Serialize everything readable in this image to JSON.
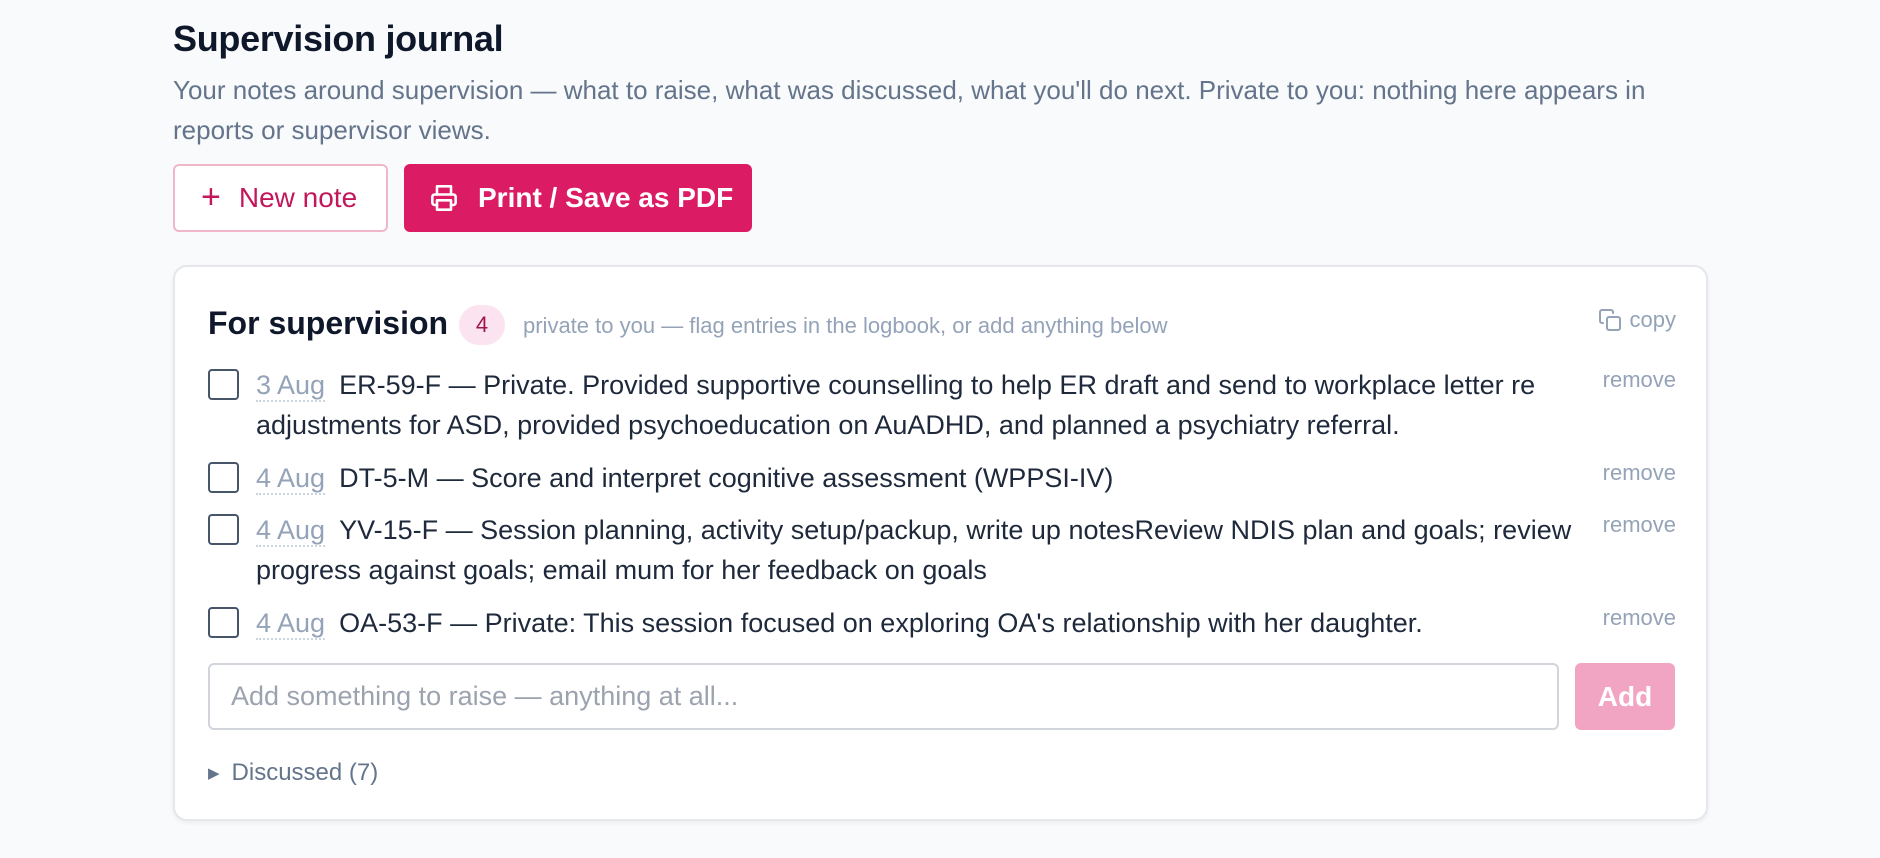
{
  "header": {
    "title": "Supervision journal",
    "subtitle": "Your notes around supervision — what to raise, what was discussed, what you'll do next. Private to you: nothing here appears in reports or supervisor views."
  },
  "toolbar": {
    "new_note_label": "New note",
    "print_label": "Print / Save as PDF"
  },
  "card": {
    "title": "For supervision",
    "count": "4",
    "hint": "private to you — flag entries in the logbook, or add anything below",
    "copy_label": "copy",
    "remove_label": "remove",
    "items": [
      {
        "date": "3 Aug",
        "text": "ER-59-F — Private. Provided supportive counselling to help ER draft and send to workplace letter re adjustments for ASD, provided psychoeducation on AuADHD, and planned a psychiatry referral."
      },
      {
        "date": "4 Aug",
        "text": "DT-5-M — Score and interpret cognitive assessment (WPPSI-IV)"
      },
      {
        "date": "4 Aug",
        "text": "YV-15-F — Session planning, activity setup/packup, write up notesReview NDIS plan and goals; review progress against goals; email mum for her feedback on goals"
      },
      {
        "date": "4 Aug",
        "text": "OA-53-F — Private: This session focused on exploring OA's relationship with her daughter."
      }
    ],
    "add_placeholder": "Add something to raise — anything at all...",
    "add_label": "Add",
    "discussed_label": "Discussed (7)"
  },
  "colors": {
    "accent": "#db1b63",
    "accent_light": "#f2a5c3",
    "badge_bg": "#fbe3f0"
  },
  "icons": [
    "plus-icon",
    "printer-icon",
    "copy-icon",
    "triangle-right-icon"
  ]
}
